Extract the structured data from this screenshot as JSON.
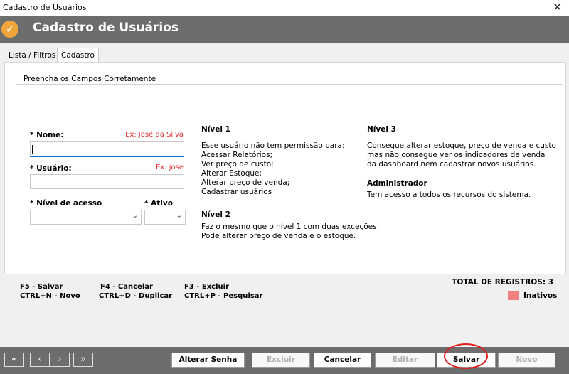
{
  "window": {
    "title": "Cadastro de Usuários",
    "close_glyph": "✕"
  },
  "header": {
    "title": "Cadastro de Usuários",
    "icon": "check-circle-icon",
    "icon_glyph": "✓",
    "accent": "#f0a53a"
  },
  "tabs": [
    {
      "label": "Lista / Filtros"
    },
    {
      "label": "Cadastro"
    }
  ],
  "form": {
    "group_title": "Preencha os Campos Corretamente",
    "nome_label": "* Nome:",
    "nome_hint": "Ex: José da Silva",
    "nome_value": "",
    "usuario_label": "* Usuário:",
    "usuario_hint": "Ex: jose",
    "usuario_value": "",
    "nivel_label": "* Nível de acesso",
    "nivel_value": "",
    "ativo_label": "* Ativo",
    "ativo_value": ""
  },
  "levels": {
    "n1_title": "Nível 1",
    "n1_lines": [
      "Esse usuário não tem permissão para:",
      "Acessar Relatórios;",
      "Ver preço de custo;",
      "Alterar Estoque;",
      "Alterar preço de venda;",
      "Cadastrar usuários"
    ],
    "n2_title": "Nível 2",
    "n2_lines": [
      "Faz o mesmo que o nível 1 com duas exceções:",
      "Pode alterar preço de venda e o estoque."
    ],
    "n3_title": "Nível 3",
    "n3_lines": [
      "Consegue alterar estoque, preço de venda e custo",
      "mas não consegue ver os indicadores de venda",
      "da dashboard nem cadastrar novos usuários."
    ],
    "admin_title": "Administrador",
    "admin_lines": [
      "Tem acesso a todos os recursos do sistema."
    ]
  },
  "shortcuts": {
    "f5": "F5 - Salvar",
    "ctrl_n": "CTRL+N - Novo",
    "f4": "F4 - Cancelar",
    "ctrl_d": "CTRL+D - Duplicar",
    "f3": "F3 - Excluir",
    "ctrl_p": "CTRL+P - Pesquisar"
  },
  "status": {
    "total": "TOTAL DE REGISTROS: 3",
    "inativos_label": "Inativos",
    "inativos_color": "#f08080"
  },
  "nav": {
    "first": "«",
    "prev": "‹",
    "next": "›",
    "last": "»"
  },
  "buttons": {
    "alterar_senha": "Alterar Senha",
    "excluir": "Excluir",
    "cancelar": "Cancelar",
    "editar": "Editar",
    "salvar": "Salvar",
    "novo": "Novo"
  }
}
